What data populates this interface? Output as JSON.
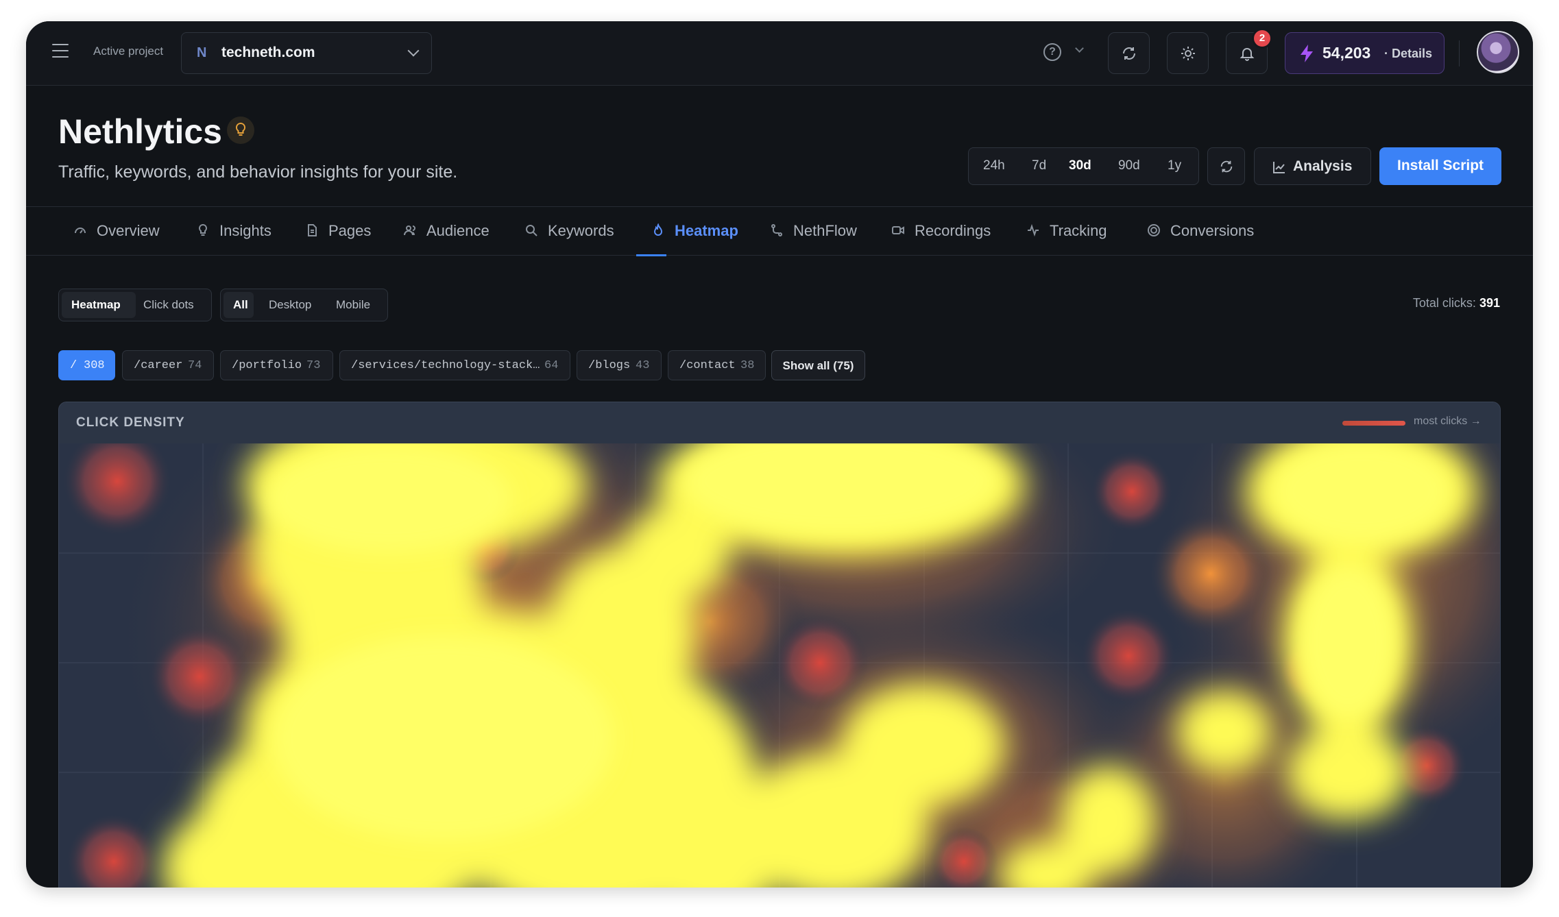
{
  "topbar": {
    "active_label": "Active project",
    "project_name": "techneth.com",
    "help_symbol": "?",
    "notification_count": "2",
    "credits_value": "54,203",
    "credits_link": "· Details"
  },
  "header": {
    "title": "Nethlytics",
    "subtitle": "Traffic, keywords, and behavior insights for your site.",
    "ranges": [
      "24h",
      "7d",
      "30d",
      "90d",
      "1y"
    ],
    "selected_range": "30d",
    "analysis_label": "Analysis",
    "install_label": "Install Script"
  },
  "tabs": [
    {
      "label": "Overview",
      "icon": "gauge-icon"
    },
    {
      "label": "Insights",
      "icon": "lightbulb-icon"
    },
    {
      "label": "Pages",
      "icon": "file-icon"
    },
    {
      "label": "Audience",
      "icon": "users-icon"
    },
    {
      "label": "Keywords",
      "icon": "search-icon"
    },
    {
      "label": "Heatmap",
      "icon": "flame-icon",
      "active": true
    },
    {
      "label": "NethFlow",
      "icon": "flow-icon"
    },
    {
      "label": "Recordings",
      "icon": "video-icon"
    },
    {
      "label": "Tracking",
      "icon": "activity-icon"
    },
    {
      "label": "Conversions",
      "icon": "target-icon"
    }
  ],
  "controls": {
    "mode": [
      "Heatmap",
      "Click dots"
    ],
    "selected_mode": "Heatmap",
    "device": [
      "All",
      "Desktop",
      "Mobile"
    ],
    "selected_device": "All",
    "total_label": "Total clicks:",
    "total_value": "391"
  },
  "pages": [
    {
      "path": "/",
      "count": "308",
      "selected": true
    },
    {
      "path": "/career",
      "count": "74"
    },
    {
      "path": "/portfolio",
      "count": "73"
    },
    {
      "path": "/services/technology-stack…",
      "count": "64"
    },
    {
      "path": "/blogs",
      "count": "43"
    },
    {
      "path": "/contact",
      "count": "38"
    }
  ],
  "show_all_label": "Show all (75)",
  "panel": {
    "title": "CLICK DENSITY",
    "legend": "most clicks →"
  },
  "colors": {
    "accent": "#3b82f6",
    "heat_high": "#ffff55",
    "heat_mid": "#f08a3a",
    "heat_low": "#d8453c",
    "panel_bg": "#2a3346"
  }
}
